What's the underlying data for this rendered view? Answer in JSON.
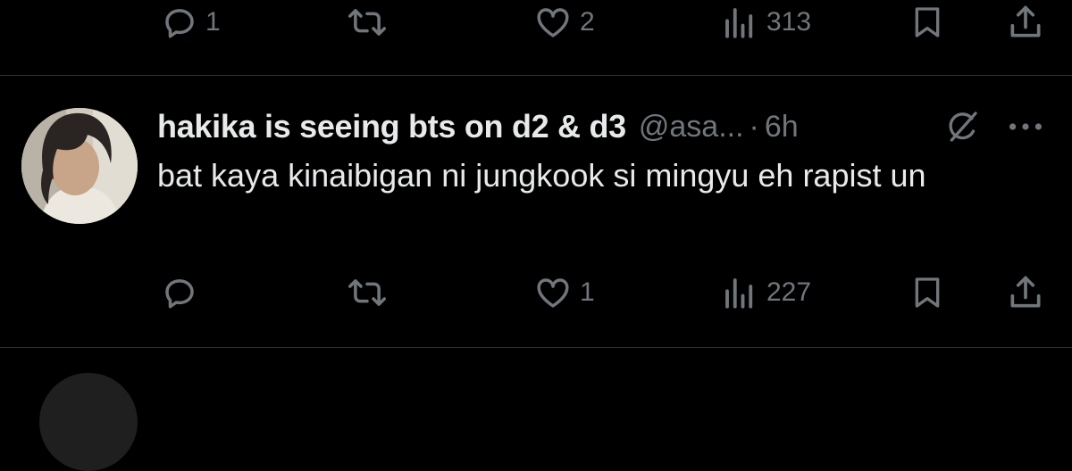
{
  "tweet_prev": {
    "replies": "1",
    "retweets": "",
    "likes": "2",
    "views": "313"
  },
  "tweet": {
    "display_name": "hakika is seeing bts on d2 & d3",
    "handle": "@asa...",
    "separator": "·",
    "time": "6h",
    "text": "bat kaya kinaibigan ni jungkook si mingyu eh rapist un",
    "replies": "",
    "retweets": "",
    "likes": "1",
    "views": "227"
  },
  "icons": {
    "reply": "reply-icon",
    "retweet": "retweet-icon",
    "like": "heart-icon",
    "views": "views-icon",
    "bookmark": "bookmark-icon",
    "share": "share-icon",
    "grok": "grok-icon",
    "more": "more-icon"
  },
  "colors": {
    "background": "#000000",
    "text": "#e7e9ea",
    "muted": "#71767b",
    "divider": "#2f3336"
  }
}
